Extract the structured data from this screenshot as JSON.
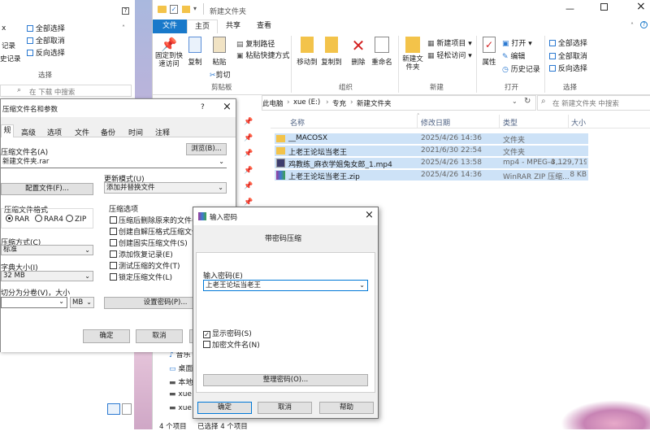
{
  "left_window": {
    "ribbon": {
      "select_all": "全部选择",
      "select_none": "全部取消",
      "invert": "反向选择",
      "group_select": "选择",
      "partial_left1": "x",
      "partial_left2": "记录",
      "partial_left3": "史记录"
    },
    "search_placeholder": "在 下载 中搜索"
  },
  "explorer": {
    "title": "新建文件夹",
    "tabs": [
      "文件",
      "主页",
      "共享",
      "查看"
    ],
    "ribbon": {
      "pin": "固定到快速访问",
      "copy": "复制",
      "paste": "粘贴",
      "copy_path": "复制路径",
      "paste_shortcut": "粘贴快捷方式",
      "cut": "剪切",
      "group_clipboard": "剪贴板",
      "move_to": "移动到",
      "copy_to": "复制到",
      "delete": "删除",
      "rename": "重命名",
      "group_organize": "组织",
      "new_folder": "新建文件夹",
      "new_item": "新建项目",
      "easy_access": "轻松访问",
      "group_new": "新建",
      "properties": "属性",
      "open": "打开",
      "edit": "编辑",
      "history": "历史记录",
      "group_open": "打开",
      "select_all": "全部选择",
      "select_none": "全部取消",
      "invert": "反向选择",
      "group_select": "选择"
    },
    "breadcrumb": [
      "此电脑",
      "xue (E:)",
      "专充",
      "新建文件夹"
    ],
    "search_placeholder": "在 新建文件夹 中搜索",
    "columns": [
      "名称",
      "修改日期",
      "类型",
      "大小"
    ],
    "files": [
      {
        "name": "__MACOSX",
        "date": "2025/4/26 14:36",
        "type": "文件夹",
        "size": ""
      },
      {
        "name": "上老王论坛当老王",
        "date": "2021/6/30 22:54",
        "type": "文件夹",
        "size": ""
      },
      {
        "name": "鸡教练_麻衣学姐兔女郎_1.mp4",
        "date": "2025/4/26 13:58",
        "type": "mp4 - MPEG-4 ...",
        "size": "3,129,719..."
      },
      {
        "name": "上老王论坛当老王.zip",
        "date": "2025/4/26 14:36",
        "type": "WinRAR ZIP 压缩...",
        "size": "8 KB"
      }
    ],
    "nav_items": [
      "音乐",
      "桌面",
      "本地",
      "xue",
      "xue"
    ],
    "status_count": "4 个项目",
    "status_selected": "已选择 4 个项目"
  },
  "archive_dialog": {
    "title": "压缩文件名和参数",
    "help_mark": "?",
    "tabs": [
      "规",
      "高级",
      "选项",
      "文件",
      "备份",
      "时间",
      "注释"
    ],
    "archive_name_label": "压缩文件名(A)",
    "browse": "浏览(B)...",
    "archive_name_value": "新建文件夹.rar",
    "profiles": "配置文件(F)...",
    "update_mode_label": "更新模式(U)",
    "update_mode_value": "添加并替换文件",
    "format_label": "压缩文件格式",
    "formats": [
      "RAR",
      "RAR4",
      "ZIP"
    ],
    "selected_format": "RAR",
    "method_label": "压缩方式(C)",
    "method_value": "标准",
    "dict_label": "字典大小(I)",
    "dict_value": "32 MB",
    "split_label": "切分为分卷(V)，大小",
    "split_unit": "MB",
    "options_label": "压缩选项",
    "options": [
      "压缩后删除原来的文件(D)",
      "创建自解压格式压缩文件",
      "创建固实压缩文件(S)",
      "添加恢复记录(E)",
      "测试压缩的文件(T)",
      "锁定压缩文件(L)"
    ],
    "set_password": "设置密码(P)...",
    "ok": "确定",
    "cancel": "取消"
  },
  "password_dialog": {
    "title": "输入密码",
    "heading": "带密码压缩",
    "enter_label": "输入密码(E)",
    "password_value": "上老王论坛当老王",
    "show_password": "显示密码(S)",
    "show_password_checked": true,
    "encrypt_names": "加密文件名(N)",
    "encrypt_names_checked": false,
    "organize": "整理密码(O)...",
    "ok": "确定",
    "cancel": "取消",
    "help": "帮助"
  }
}
